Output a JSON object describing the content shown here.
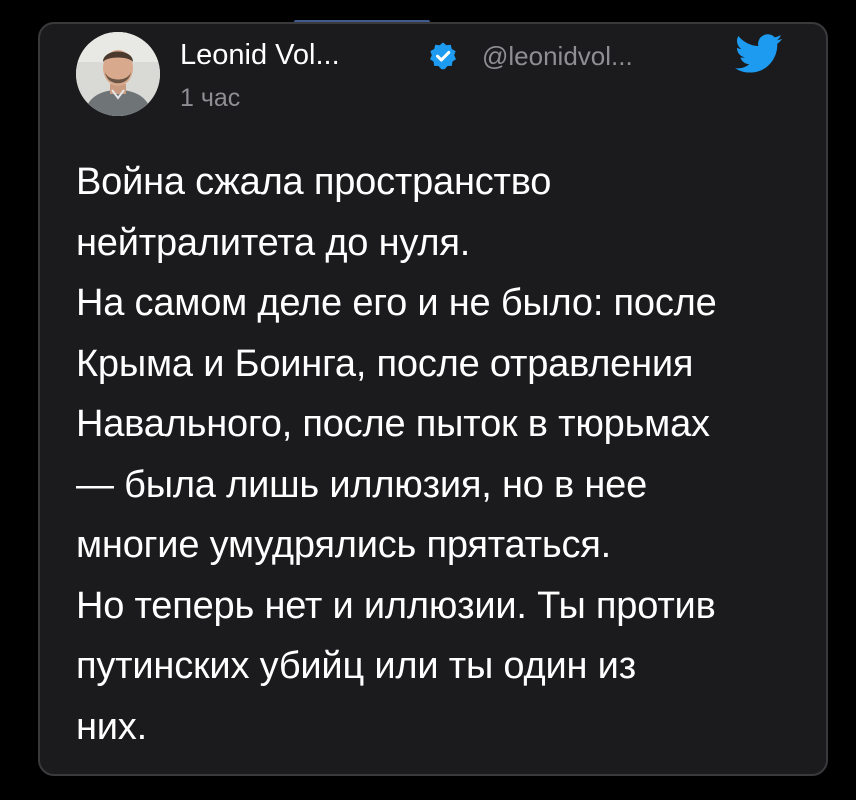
{
  "tweet": {
    "author_name": "Leonid Vol...",
    "handle": "@leonidvol...",
    "timestamp": "1 час",
    "verified_icon": "verified-badge-icon",
    "platform_icon": "twitter-bird-icon",
    "lines": [
      "Война сжала пространство",
      "нейтралитета до нуля.",
      "На самом деле его и не было: после",
      "Крыма и Боинга, после отравления",
      "Навального, после пыток в тюрьмах",
      "— была лишь иллюзия, но в нее",
      "многие умудрялись прятаться.",
      "Но теперь нет и иллюзии. Ты против",
      "путинских убийц или ты один из",
      "них."
    ]
  },
  "colors": {
    "background": "#000000",
    "card": "#1b1b1d",
    "card_border": "#3a3a3c",
    "text_primary": "#ffffff",
    "text_secondary": "#8e8e93",
    "twitter_blue": "#1d9bf0",
    "tab_indicator": "#3f5a8c"
  }
}
